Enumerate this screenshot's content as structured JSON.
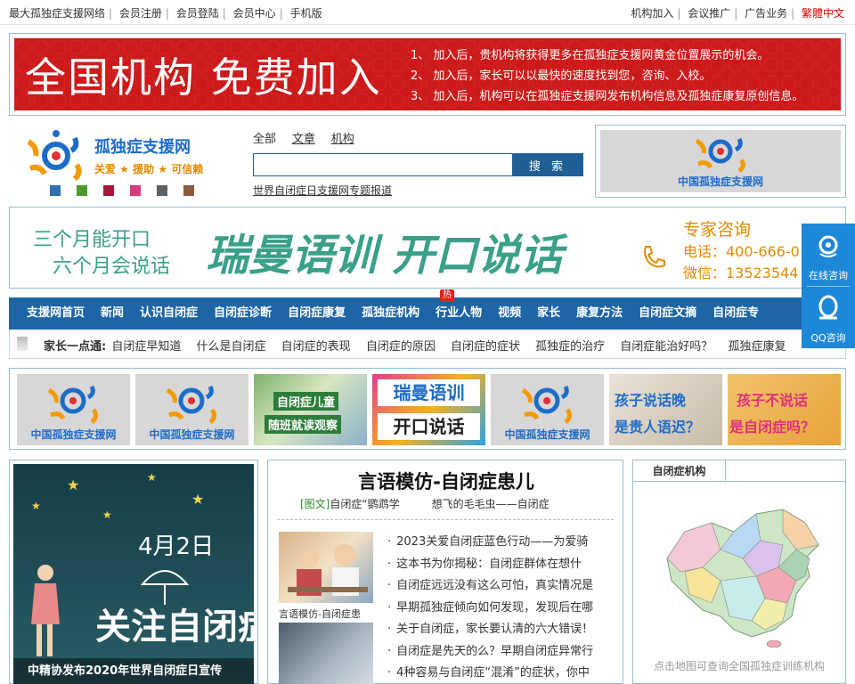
{
  "topbar": {
    "left_links": [
      "最大孤独症支援网络",
      "会员注册",
      "会员登陆",
      "会员中心",
      "手机版"
    ],
    "right_links": [
      "机构加入",
      "会议推广",
      "广告业务"
    ],
    "lang_link": "繁體中文"
  },
  "banner": {
    "headline": "全国机构  免费加入",
    "items": [
      "1、  加入后，贵机构将获得更多在孤独症支援网黄金位置展示的机会。",
      "2、  加入后，家长可以以最快的速度找到您，咨询、入校。",
      "3、  加入后，机构可以在孤独症支援网发布机构信息及孤独症康复原创信息。"
    ]
  },
  "logo": {
    "title": "孤独症支援网",
    "slogan": "关爱 ★ 援助 ★ 可信赖",
    "swatches": [
      "#2f6fb0",
      "#4a9a2a",
      "#a3163a",
      "#d93b7c",
      "#5b6166",
      "#8a5a3c"
    ]
  },
  "search": {
    "tabs": [
      "全部",
      "文章",
      "机构"
    ],
    "placeholder": "",
    "button": "搜 索",
    "special_link": "世界自闭症日支援网专题报道"
  },
  "right_logo": {
    "caption": "中国孤独症支援网"
  },
  "ad": {
    "line1": "三个月能开口",
    "line2": "六个月会说话",
    "brand": "瑞曼语训  开口说话",
    "expert": "专家咨询",
    "tel": "电话：400-666-0",
    "wechat": "微信：13523544"
  },
  "nav": {
    "items": [
      "支援网首页",
      "新闻",
      "认识自闭症",
      "自闭症诊断",
      "自闭症康复",
      "孤独症机构",
      "行业人物",
      "视频",
      "家长",
      "康复方法",
      "自闭症文摘",
      "自闭症专"
    ],
    "hot_badge": "热"
  },
  "subnav": {
    "label": "家长一点通:",
    "items": [
      "自闭症早知道",
      "什么是自闭症",
      "自闭症的表现",
      "自闭症的原因",
      "自闭症的症状",
      "孤独症的治疗",
      "自闭症能治好吗？",
      "孤独症康复"
    ]
  },
  "image_row": {
    "logo_caption": "中国孤独症支援网",
    "tile3_line1": "自闭症儿童",
    "tile3_line2": "随班就读观察",
    "tile4_line1": "瑞曼语训",
    "tile4_line2": "开口说话",
    "tile6_line1": "孩子说话晚",
    "tile6_line2": "是贵人语迟？",
    "tile7_line1": "孩子不说话",
    "tile7_line2": "是自闭症吗？"
  },
  "left_poster": {
    "date": "4月2日",
    "slogan": "关注自闭症",
    "caption": "中精协发布2020年世界自闭症日宣传"
  },
  "middle": {
    "headline": "言语模仿-自闭症患儿",
    "tag": "[图文]",
    "subline_a": "自闭症“鹦鹉学",
    "subline_b": "想飞的毛毛虫——自闭症",
    "thumb_caption": "言语模仿-自闭症患",
    "news": [
      "2023关爱自闭症蓝色行动——为爱骑",
      "这本书为你揭秘：自闭症群体在想什",
      "自闭症远远没有这么可怕，真实情况是",
      "早期孤独症倾向如何发现，发现后在哪",
      "关于自闭症，家长要认清的六大错误！",
      "自闭症是先天的么？早期自闭症异常行",
      "4种容易与自闭症“混淆”的症状，你中"
    ]
  },
  "right_panel": {
    "title": "自闭症机构",
    "footer": "点击地图可查询全国孤独症训练机构"
  },
  "float": {
    "online": "在线咨询",
    "qq": "QQ咨询"
  }
}
